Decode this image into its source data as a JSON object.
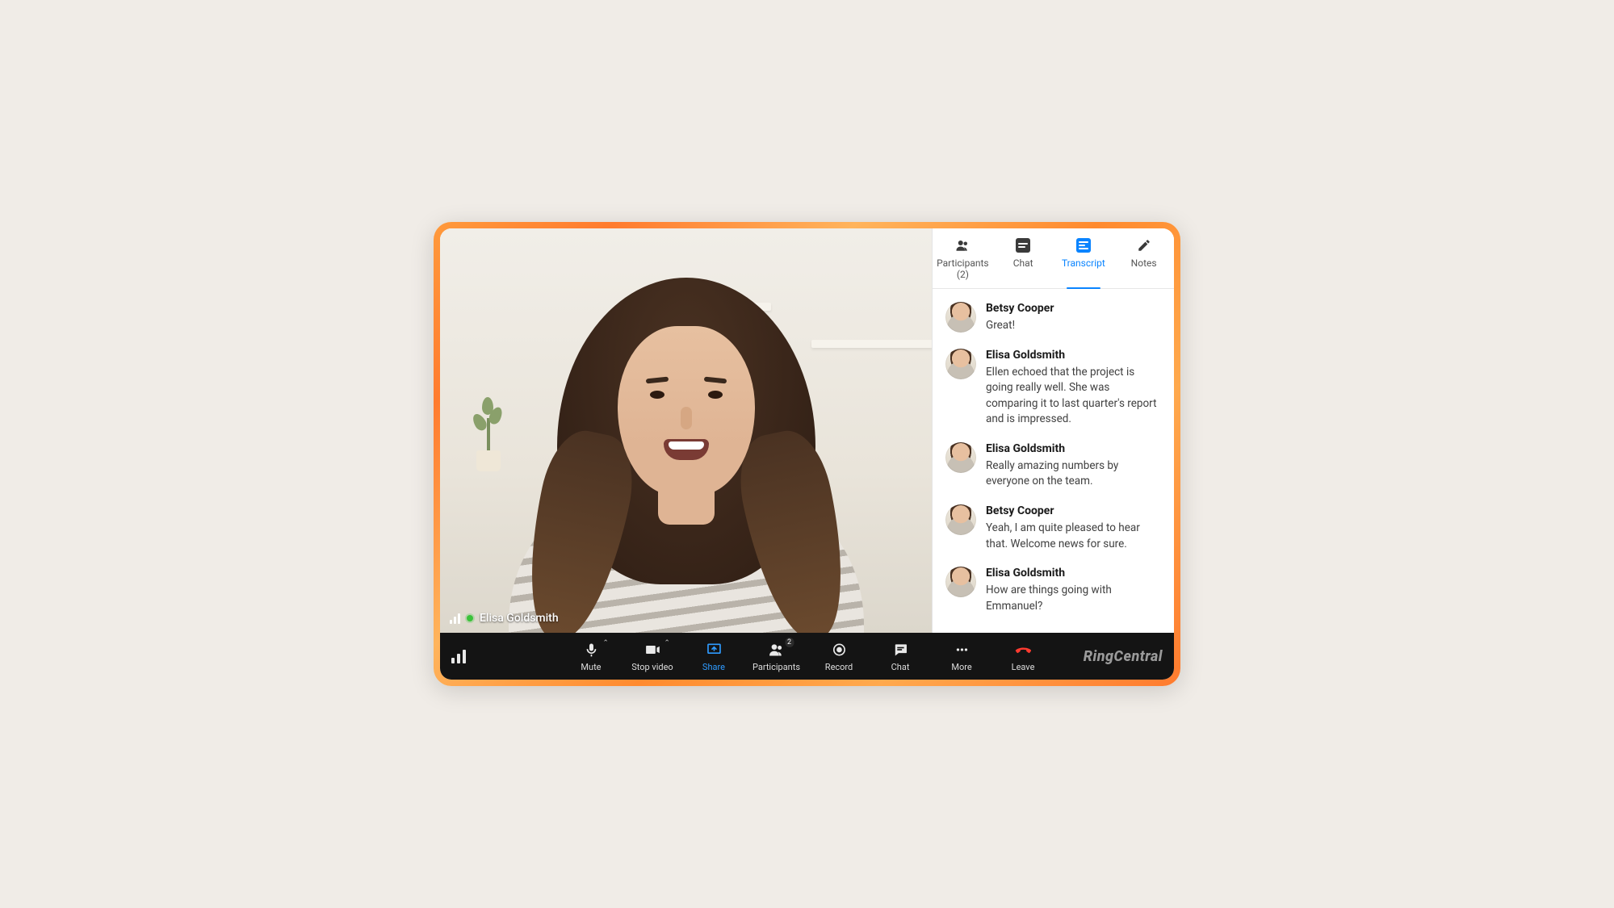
{
  "brand": "RingCentral",
  "video": {
    "speaker_name": "Elisa Goldsmith"
  },
  "tabs": {
    "participants": {
      "label": "Participants",
      "count": 2
    },
    "chat": {
      "label": "Chat"
    },
    "transcript": {
      "label": "Transcript"
    },
    "notes": {
      "label": "Notes"
    },
    "active": "transcript"
  },
  "transcript": [
    {
      "name": "Betsy Cooper",
      "text": "Great!"
    },
    {
      "name": "Elisa Goldsmith",
      "text": "Ellen echoed that the project is going really well. She was comparing it to last quarter's report and is impressed."
    },
    {
      "name": "Elisa Goldsmith",
      "text": "Really amazing numbers by everyone on the team."
    },
    {
      "name": "Betsy Cooper",
      "text": "Yeah, I am quite pleased to hear that. Welcome news for sure."
    },
    {
      "name": "Elisa Goldsmith",
      "text": "How are things going with Emmanuel?"
    }
  ],
  "controls": {
    "mute": "Mute",
    "stop_video": "Stop video",
    "share": "Share",
    "participants": "Participants",
    "participants_count": 2,
    "record": "Record",
    "chat": "Chat",
    "more": "More",
    "leave": "Leave"
  }
}
